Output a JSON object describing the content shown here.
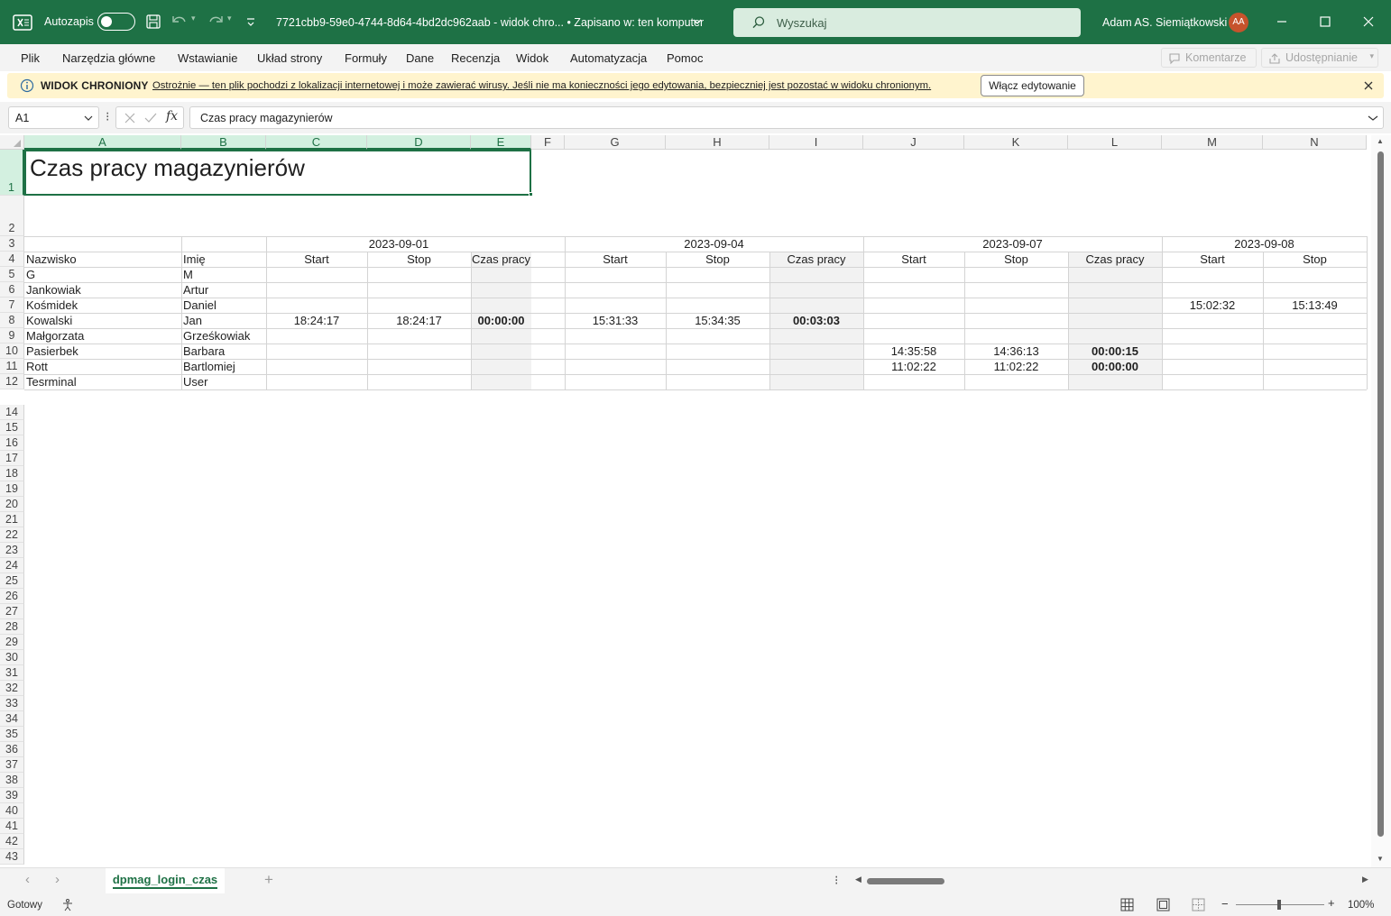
{
  "titlebar": {
    "autosave_label": "Autozapis",
    "document_title": "7721cbb9-59e0-4744-8d64-4bd2dc962aab  -  widok chro...  •  Zapisano w: ten komputer",
    "search_placeholder": "Wyszukaj",
    "user_name": "Adam AS. Siemiątkowski",
    "user_initials": "AA"
  },
  "menu": {
    "items": [
      "Plik",
      "Narzędzia główne",
      "Wstawianie",
      "Układ strony",
      "Formuły",
      "Dane",
      "Recenzja",
      "Widok",
      "Automatyzacja",
      "Pomoc"
    ],
    "comments_label": "Komentarze",
    "share_label": "Udostępnianie"
  },
  "protected_view": {
    "title": "WIDOK CHRONIONY",
    "message": "Ostrożnie — ten plik pochodzi z lokalizacji internetowej i może zawierać wirusy. Jeśli nie ma konieczności jego edytowania, bezpieczniej jest pozostać w widoku chronionym.",
    "button": "Włącz edytowanie"
  },
  "formula_bar": {
    "name_box": "A1",
    "fx_label": "fx",
    "content": "Czas pracy magazynierów"
  },
  "sheet": {
    "columns": [
      "A",
      "B",
      "C",
      "D",
      "E",
      "F",
      "G",
      "H",
      "I",
      "J",
      "K",
      "L",
      "M",
      "N"
    ],
    "row_numbers": [
      "1",
      "2",
      "3",
      "4",
      "5",
      "6",
      "7",
      "8",
      "9",
      "10",
      "11",
      "12",
      "14",
      "15",
      "16",
      "17",
      "18",
      "19",
      "20",
      "21",
      "22",
      "23",
      "24",
      "25",
      "26",
      "27",
      "28",
      "29",
      "30",
      "31",
      "32",
      "33",
      "34",
      "35",
      "36",
      "37",
      "38",
      "39",
      "40",
      "41",
      "42",
      "43"
    ],
    "title": "Czas pracy magazynierów",
    "dates": [
      "2023-09-01",
      "2023-09-04",
      "2023-09-07",
      "2023-09-08"
    ],
    "headers": {
      "surname": "Nazwisko",
      "name": "Imię",
      "start": "Start",
      "stop": "Stop",
      "work_time": "Czas pracy"
    },
    "rows": [
      {
        "surname": "G",
        "name": "M",
        "c": "",
        "d": "",
        "e": "",
        "g": "",
        "h": "",
        "i": "",
        "j": "",
        "k": "",
        "l": "",
        "m": "",
        "n": ""
      },
      {
        "surname": "Jankowiak",
        "name": "Artur",
        "c": "",
        "d": "",
        "e": "",
        "g": "",
        "h": "",
        "i": "",
        "j": "",
        "k": "",
        "l": "",
        "m": "",
        "n": ""
      },
      {
        "surname": "Kośmidek",
        "name": "Daniel",
        "c": "",
        "d": "",
        "e": "",
        "g": "",
        "h": "",
        "i": "",
        "j": "",
        "k": "",
        "l": "",
        "m": "15:02:32",
        "n": "15:13:49"
      },
      {
        "surname": "Kowalski",
        "name": "Jan",
        "c": "18:24:17",
        "d": "18:24:17",
        "e": "00:00:00",
        "g": "15:31:33",
        "h": "15:34:35",
        "i": "00:03:03",
        "j": "",
        "k": "",
        "l": "",
        "m": "",
        "n": ""
      },
      {
        "surname": "Małgorzata",
        "name": "Grześkowiak",
        "c": "",
        "d": "",
        "e": "",
        "g": "",
        "h": "",
        "i": "",
        "j": "",
        "k": "",
        "l": "",
        "m": "",
        "n": ""
      },
      {
        "surname": "Pasierbek",
        "name": "Barbara",
        "c": "",
        "d": "",
        "e": "",
        "g": "",
        "h": "",
        "i": "",
        "j": "14:35:58",
        "k": "14:36:13",
        "l": "00:00:15",
        "m": "",
        "n": ""
      },
      {
        "surname": "Rott",
        "name": "Bartlomiej",
        "c": "",
        "d": "",
        "e": "",
        "g": "",
        "h": "",
        "i": "",
        "j": "11:02:22",
        "k": "11:02:22",
        "l": "00:00:00",
        "m": "",
        "n": ""
      },
      {
        "surname": "Tesrminal",
        "name": "User",
        "c": "",
        "d": "",
        "e": "",
        "g": "",
        "h": "",
        "i": "",
        "j": "",
        "k": "",
        "l": "",
        "m": "",
        "n": ""
      }
    ]
  },
  "tabs": {
    "sheet_name": "dpmag_login_czas"
  },
  "statusbar": {
    "ready": "Gotowy",
    "zoom": "100%"
  },
  "colors": {
    "brand": "#1e7145",
    "protected_bar": "#fff4ce",
    "avatar": "#c6532c"
  }
}
